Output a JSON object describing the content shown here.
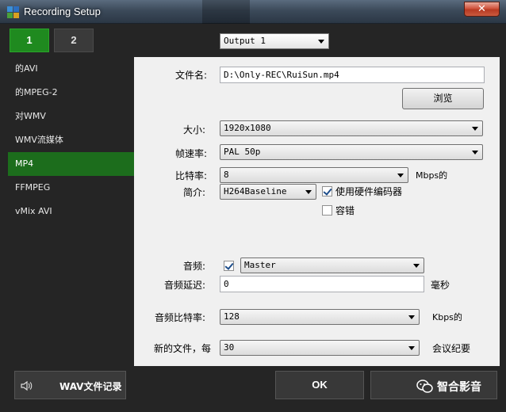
{
  "window": {
    "title": "Recording Setup",
    "close_glyph": "✕"
  },
  "tabs": [
    {
      "label": "1",
      "active": true
    },
    {
      "label": "2",
      "active": false
    }
  ],
  "output_select": {
    "value": "Output 1"
  },
  "sidebar": {
    "items": [
      {
        "label": "的AVI"
      },
      {
        "label": "的MPEG-2"
      },
      {
        "label": "对WMV"
      },
      {
        "label": "WMV流媒体"
      },
      {
        "label": "MP4",
        "selected": true
      },
      {
        "label": "FFMPEG"
      },
      {
        "label": "vMix AVI"
      }
    ]
  },
  "form": {
    "filename": {
      "label": "文件名:",
      "value": "D:\\Only-REC\\RuiSun.mp4"
    },
    "browse_label": "浏览",
    "size": {
      "label": "大小:",
      "value": "1920x1080"
    },
    "framerate": {
      "label": "帧速率:",
      "value": "PAL 50p"
    },
    "bitrate": {
      "label": "比特率:",
      "value": "8",
      "unit": "Mbps的"
    },
    "profile": {
      "label": "简介:",
      "value": "H264Baseline"
    },
    "hw_encoder": {
      "label": "使用硬件编码器",
      "checked": true
    },
    "fault_tolerance": {
      "label": "容错",
      "checked": false
    },
    "audio": {
      "label": "音频:",
      "checked": true,
      "value": "Master"
    },
    "audio_delay": {
      "label": "音频延迟:",
      "value": "0",
      "unit": "毫秒"
    },
    "audio_bitrate": {
      "label": "音频比特率:",
      "value": "128",
      "unit": "Kbps的"
    },
    "new_file": {
      "label": "新的文件，每",
      "value": "30",
      "unit": "会议纪要"
    }
  },
  "footer": {
    "wav_label": "WAV文件记录",
    "ok_label": "OK",
    "watermark_text": "智合影音"
  },
  "colors": {
    "accent_green": "#1f8a1f",
    "selected_green": "#1c6d1c",
    "dark_bg": "#252525"
  }
}
